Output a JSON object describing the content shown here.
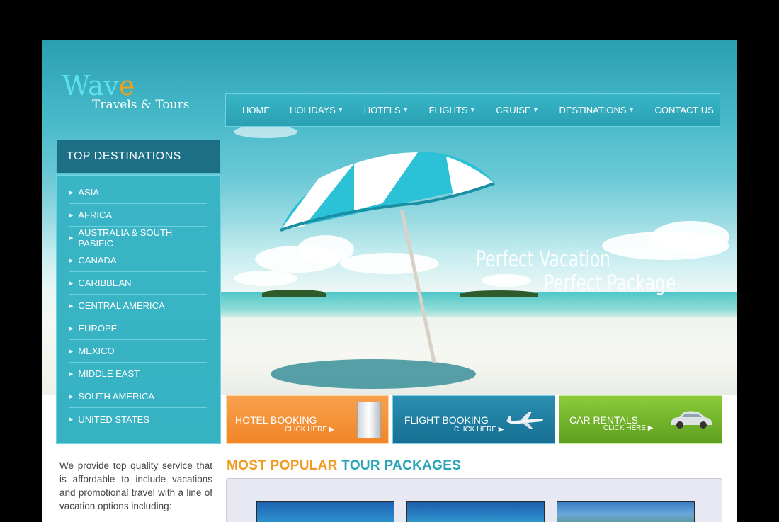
{
  "logo": {
    "name_main": "Wav",
    "name_accent": "e",
    "subtitle": "Travels & Tours"
  },
  "nav": [
    {
      "label": "HOME",
      "dropdown": false
    },
    {
      "label": "HOLIDAYS",
      "dropdown": true
    },
    {
      "label": "HOTELS",
      "dropdown": true
    },
    {
      "label": "FLIGHTS",
      "dropdown": true
    },
    {
      "label": "CRUISE",
      "dropdown": true
    },
    {
      "label": "DESTINATIONS",
      "dropdown": true
    },
    {
      "label": "CONTACT US",
      "dropdown": false
    }
  ],
  "caret": "▼",
  "hero": {
    "line1": "Perfect Vacation",
    "line2": "Perfect Package"
  },
  "sidebar": {
    "title": "TOP DESTINATIONS",
    "items": [
      "ASIA",
      "AFRICA",
      "AUSTRALIA & SOUTH PASIFIC",
      "CANADA",
      "CARIBBEAN",
      "CENTRAL AMERICA",
      "EUROPE",
      "MEXICO",
      "MIDDLE EAST",
      "SOUTH AMERICA",
      "UNITED STATES"
    ]
  },
  "bookings": {
    "hotel": {
      "title": "HOTEL BOOKING",
      "cta": "CLICK HERE ▶"
    },
    "flight": {
      "title": "FLIGHT BOOKING",
      "cta": "CLICK HERE ▶"
    },
    "car": {
      "title": "CAR RENTALS",
      "cta": "CLICK HERE ▶"
    }
  },
  "intro": "We provide top quality service that is affordable to include vacations and promotional travel with a line of vacation options including:",
  "popular": {
    "part1": "MOST POPULAR",
    "part2": "TOUR PACKAGES"
  },
  "colors": {
    "accent_orange": "#f39a21",
    "accent_teal": "#2aa5b8",
    "logo_teal": "#5ee2ea"
  }
}
